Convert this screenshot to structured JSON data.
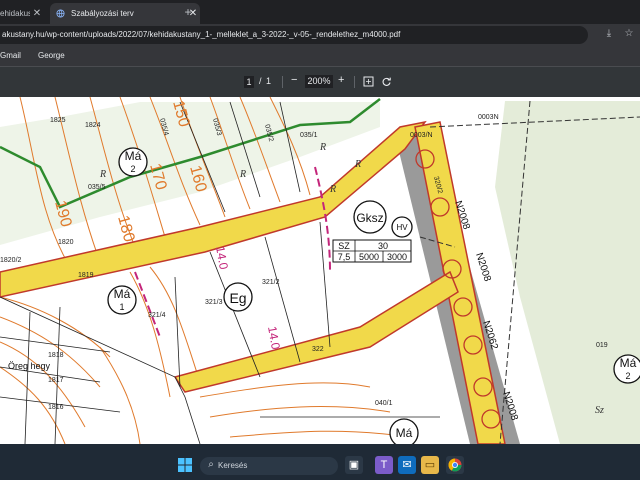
{
  "browser": {
    "tabs": [
      {
        "title": "ehidakus",
        "active": false
      },
      {
        "title": "Szabályozási terv",
        "active": true
      }
    ],
    "new_tab_label": "+",
    "url": "akustany.hu/wp-content/uploads/2022/07/kehidakustany_1-_melleklet_a_3-2022-_v-05-_rendelethez_m4000.pdf",
    "bookmarks": [
      "Gmail",
      "George"
    ]
  },
  "pdf_toolbar": {
    "page_current": "1",
    "page_separator": "/",
    "page_total": "1",
    "zoom_out": "−",
    "zoom": "200%",
    "zoom_in": "+"
  },
  "map": {
    "contours": [
      "190",
      "180",
      "170",
      "160",
      "150",
      "160",
      "140"
    ],
    "zones": [
      {
        "code": "Má",
        "num": "2"
      },
      {
        "code": "Má",
        "num": "1"
      },
      {
        "code": "Eg",
        "num": ""
      },
      {
        "code": "Gksz",
        "num": ""
      },
      {
        "code": "Má",
        "num": "2"
      },
      {
        "code": "Má",
        "num": ""
      }
    ],
    "parcels": [
      "035/4",
      "035/3",
      "035/2",
      "035/1",
      "035/5",
      "321/3",
      "321/2",
      "321/4",
      "322",
      "040/1",
      "019",
      "1819",
      "1820",
      "1818",
      "1817",
      "1816",
      "1824",
      "1825",
      "320/2",
      "0003/N",
      "0003N",
      "1820/2"
    ],
    "letters": [
      "R",
      "R",
      "R",
      "R",
      "R",
      "Sz"
    ],
    "road_labels": [
      "N2008",
      "N2008",
      "N2062",
      "N2008"
    ],
    "hv_label": "HV",
    "place_name": "Öreg hegy",
    "param_table": [
      [
        "SZ",
        "30"
      ],
      [
        "7,5",
        "5000",
        "3000"
      ]
    ],
    "magenta_labels": [
      "14.0",
      "14.0"
    ]
  },
  "taskbar": {
    "search_label": "Keresés"
  },
  "colors": {
    "contour": "#e07a2c",
    "green_boundary": "#2e8b2e",
    "road_fill": "#f1d94a",
    "road_border": "#c0392b",
    "gray_strip": "#9a9a9a",
    "light_green": "#e4ecd9",
    "magenta": "#c4257a"
  }
}
